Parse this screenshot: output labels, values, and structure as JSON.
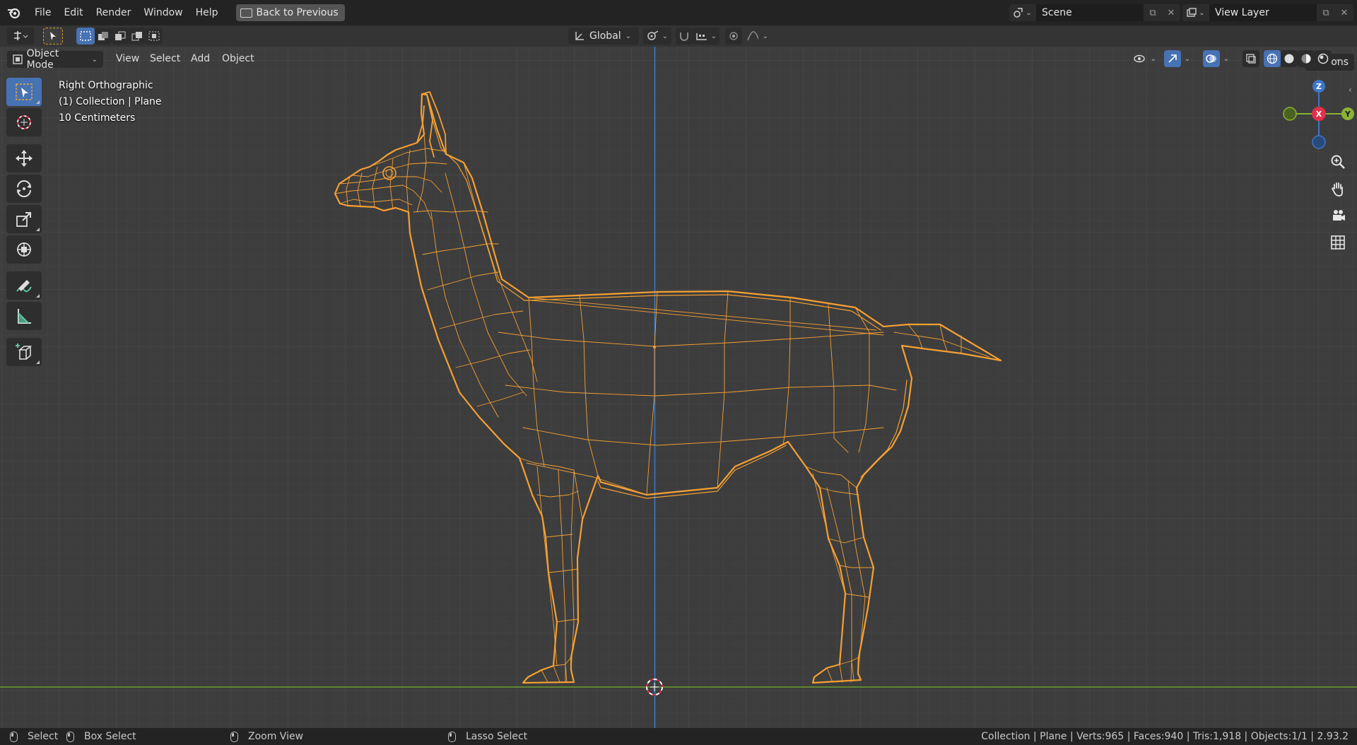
{
  "topbar": {
    "menus": [
      "File",
      "Edit",
      "Render",
      "Window",
      "Help"
    ],
    "back_label": "Back to Previous",
    "scene": "Scene",
    "view_layer": "View Layer"
  },
  "header": {
    "transform_orientation": "Global",
    "options_label": "Options",
    "mode": "Object Mode",
    "menus": [
      "View",
      "Select",
      "Add",
      "Object"
    ]
  },
  "viewport": {
    "view_name": "Right Orthographic",
    "collection_info": "(1) Collection | Plane",
    "scale_info": "10 Centimeters",
    "axes": {
      "z": "Z",
      "x": "X",
      "y": "Y"
    },
    "wire_color": "#f5a033",
    "grid_color": "#474747",
    "axis_y_color": "#6c9e2b",
    "axis_z_color": "#3f76c9"
  },
  "statusbar": {
    "select": "Select",
    "box_select": "Box Select",
    "zoom_view": "Zoom View",
    "lasso_select": "Lasso Select",
    "stats": "Collection | Plane | Verts:965 | Faces:940 | Tris:1,918 | Objects:1/1 | 2.93.2"
  }
}
